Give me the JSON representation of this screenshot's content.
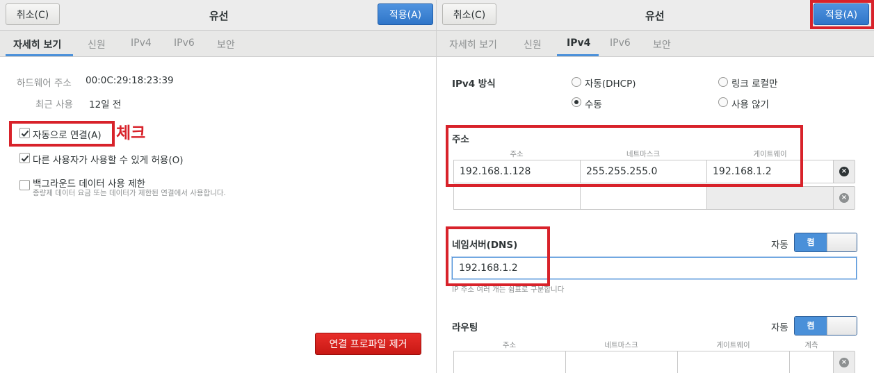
{
  "left": {
    "header": {
      "cancel_label": "취소(C)",
      "title": "유선",
      "apply_label": "적용(A)"
    },
    "tabs": [
      "자세히 보기",
      "신원",
      "IPv4",
      "IPv6",
      "보안"
    ],
    "details": {
      "hw_label": "하드웨어 주소",
      "hw_value": "00:0C:29:18:23:39",
      "last_used_label": "최근 사용",
      "last_used_value": "12일 전"
    },
    "checks": [
      {
        "label": "자동으로 연결(A)",
        "checked": true
      },
      {
        "label": "다른 사용자가 사용할 수 있게 허용(O)",
        "checked": true
      },
      {
        "label": "백그라운드 데이터 사용 제한",
        "checked": false,
        "sub": "종량제 데이터 요금 또는 데이터가 제한된 연결에서 사용합니다."
      }
    ],
    "annotation": "체크",
    "remove_label": "연결 프로파일 제거"
  },
  "right": {
    "header": {
      "cancel_label": "취소(C)",
      "title": "유선",
      "apply_label": "적용(A)"
    },
    "tabs": [
      "자세히 보기",
      "신원",
      "IPv4",
      "IPv6",
      "보안"
    ],
    "ipv4_method_label": "IPv4 방식",
    "methods": {
      "auto": "자동(DHCP)",
      "manual": "수동",
      "link_local": "링크 로컬만",
      "disable": "사용 않기"
    },
    "address": {
      "label": "주소",
      "col_address": "주소",
      "col_netmask": "네트마스크",
      "col_gateway": "게이트웨이",
      "row1": {
        "address": "192.168.1.128",
        "netmask": "255.255.255.0",
        "gateway": "192.168.1.2"
      }
    },
    "dns": {
      "label": "네임서버(DNS)",
      "auto_label": "자동",
      "switch_label": "켬",
      "value": "192.168.1.2",
      "hint": "IP 주소 여러 개는 쉼표로 구분합니다"
    },
    "routes": {
      "label": "라우팅",
      "auto_label": "자동",
      "switch_label": "켬",
      "col_address": "주소",
      "col_netmask": "네트마스크",
      "col_gateway": "게이트웨이",
      "col_metric": "계측"
    }
  },
  "colors": {
    "accent": "#4a90d9",
    "annotation_red": "#d8222a",
    "destructive": "#d21d19"
  }
}
